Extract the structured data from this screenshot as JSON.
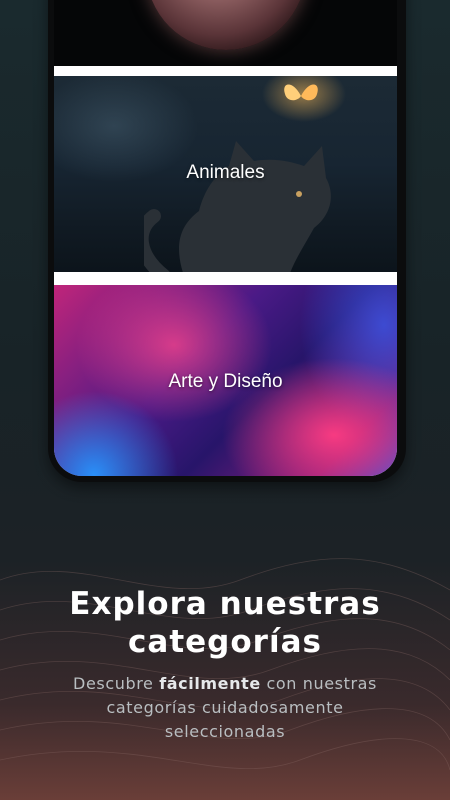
{
  "categories": [
    {
      "label": ""
    },
    {
      "label": "Animales"
    },
    {
      "label": "Arte y Diseño"
    }
  ],
  "onboarding": {
    "title": "Explora nuestras categorías",
    "subtitle_before": "Descubre ",
    "subtitle_bold": "fácilmente",
    "subtitle_after": " con nuestras categorías cuidadosamente seleccionadas"
  }
}
